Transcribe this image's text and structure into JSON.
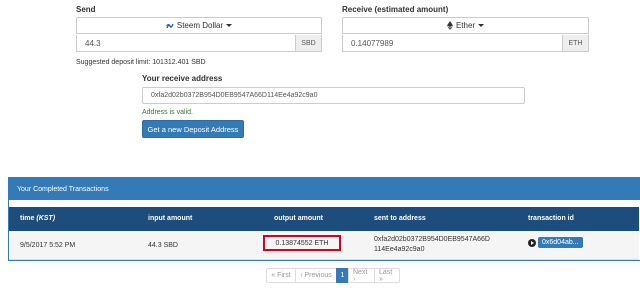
{
  "send": {
    "label": "Send",
    "currency": "Steem Dollar",
    "currency_icon": "steem-icon",
    "amount": "44.3",
    "unit": "SBD"
  },
  "receive": {
    "label": "Receive (estimated amount)",
    "currency": "Ether",
    "currency_icon": "ether-icon",
    "amount": "0.14077989",
    "unit": "ETH"
  },
  "deposit_limit": "Suggested deposit limit: 101312.401 SBD",
  "receive_address": {
    "label": "Your receive address",
    "value": "0xfa2d02b0372B954D0EB9547A66D114Ee4a92c9a0",
    "status": "Address is valid.",
    "button": "Get a new Deposit Address"
  },
  "transactions": {
    "title": "Your Completed Transactions",
    "columns": [
      "time (KST)",
      "input amount",
      "output amount",
      "sent to address",
      "transaction id"
    ],
    "time_label": "time",
    "time_zone": "(KST)",
    "rows": [
      {
        "time": "9/5/2017 5:52 PM",
        "input": "44.3 SBD",
        "output": "0.13874552 ETH",
        "address_line1": "0xfa2d02b0372B954D0EB9547A66D",
        "address_line2": "114Ee4a92c9a0",
        "tx_id": "0x6d04ab..."
      }
    ]
  },
  "pagination": {
    "first": "« First",
    "previous": "‹ Previous",
    "current": "1",
    "next": "Next ›",
    "last": "Last »"
  },
  "colors": {
    "primary": "#337ab7",
    "table_header": "#1d4d7c",
    "highlight": "#d9001b",
    "valid": "#3c763d"
  }
}
